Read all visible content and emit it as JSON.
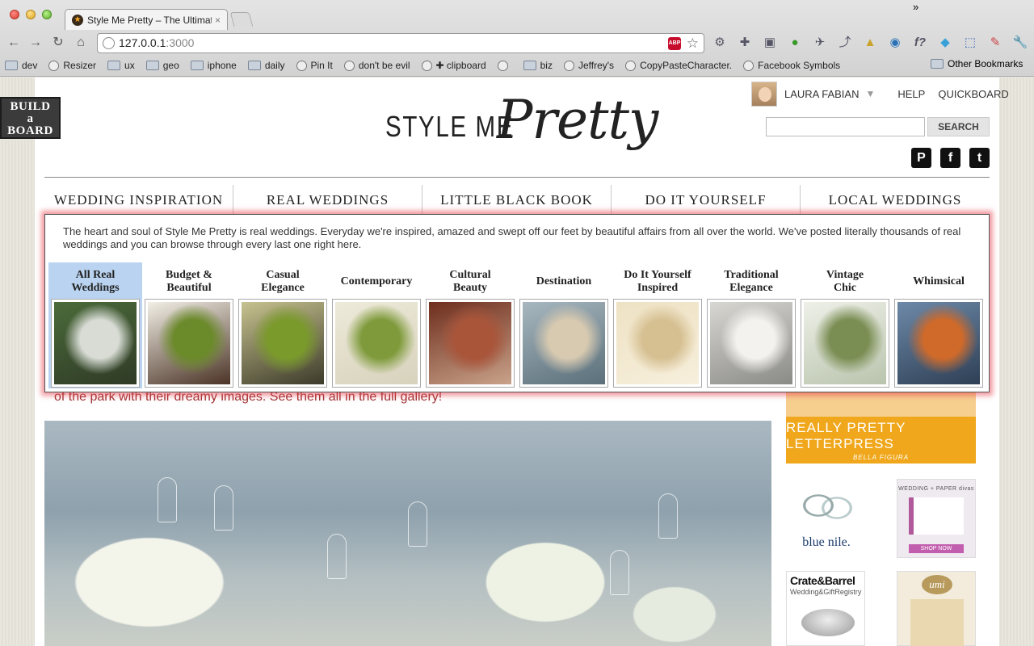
{
  "browser": {
    "tab_title": "Style Me Pretty – The Ultimat",
    "tab_close": "×",
    "url_host": "127.0.0.1",
    "url_port": ":3000",
    "abp_label": "ABP",
    "bookmarks": [
      {
        "label": "dev",
        "icon": "folder"
      },
      {
        "label": "Resizer",
        "icon": "globe"
      },
      {
        "label": "ux",
        "icon": "folder"
      },
      {
        "label": "geo",
        "icon": "folder"
      },
      {
        "label": "iphone",
        "icon": "folder"
      },
      {
        "label": "daily",
        "icon": "folder"
      },
      {
        "label": "Pin It",
        "icon": "globe"
      },
      {
        "label": "don't be evil",
        "icon": "globe"
      },
      {
        "label": "✚ clipboard",
        "icon": "globe"
      },
      {
        "label": "",
        "icon": "globe"
      },
      {
        "label": "biz",
        "icon": "folder"
      },
      {
        "label": "Jeffrey's",
        "icon": "globe"
      },
      {
        "label": "CopyPasteCharacter.",
        "icon": "globe"
      },
      {
        "label": "Facebook Symbols",
        "icon": "globe"
      }
    ],
    "more_bookmarks": "»",
    "other_bookmarks": "Other Bookmarks"
  },
  "site": {
    "build_board": [
      "BUILD",
      "a",
      "BOARD"
    ],
    "logo_left": "STYLE ME",
    "logo_script": "Pretty",
    "user_name": "LAURA FABIAN",
    "help": "HELP",
    "quickboard": "QUICKBOARD",
    "search_button": "SEARCH",
    "search_value": "",
    "social": [
      {
        "name": "pinterest",
        "glyph": "P"
      },
      {
        "name": "facebook",
        "glyph": "f"
      },
      {
        "name": "twitter",
        "glyph": "t"
      }
    ],
    "nav": [
      {
        "label": "WEDDING INSPIRATION",
        "active": false
      },
      {
        "label": "REAL WEDDINGS",
        "active": true
      },
      {
        "label": "LITTLE BLACK BOOK",
        "active": false
      },
      {
        "label": "DO IT YOURSELF",
        "active": false
      },
      {
        "label": "LOCAL WEDDINGS",
        "active": false
      }
    ]
  },
  "dropdown": {
    "intro": "The heart and soul of Style Me Pretty is real weddings. Everyday we're inspired, amazed and swept off our feet by beautiful affairs from all over the world. We've posted literally thousands of real weddings and you can browse through every last one right here.",
    "categories": [
      {
        "label": "All Real\nWeddings",
        "active": true,
        "colors": [
          "#4b6b3a",
          "#d8dcd5",
          "#2f3a26"
        ]
      },
      {
        "label": "Budget &\nBeautiful",
        "active": false,
        "colors": [
          "#f2efe6",
          "#6b8a2a",
          "#4b3326"
        ]
      },
      {
        "label": "Casual\nElegance",
        "active": false,
        "colors": [
          "#c7c28f",
          "#7a9a2b",
          "#3c3a2a"
        ]
      },
      {
        "label": "Contemporary",
        "active": false,
        "colors": [
          "#eeeada",
          "#7e9a3a",
          "#d7d2bc"
        ]
      },
      {
        "label": "Cultural\nBeauty",
        "active": false,
        "colors": [
          "#6e2e1e",
          "#a9553a",
          "#c9a28a"
        ]
      },
      {
        "label": "Destination",
        "active": false,
        "colors": [
          "#a8b7bf",
          "#d8cab0",
          "#5a6f7a"
        ]
      },
      {
        "label": "Do It Yourself\nInspired",
        "active": false,
        "colors": [
          "#eee2c4",
          "#d6c092",
          "#f7efdc"
        ]
      },
      {
        "label": "Traditional\nElegance",
        "active": false,
        "colors": [
          "#d8d7d2",
          "#f3f2ee",
          "#8a8a86"
        ]
      },
      {
        "label": "Vintage\nChic",
        "active": false,
        "colors": [
          "#eef0e8",
          "#7a8d52",
          "#b9c4ad"
        ]
      },
      {
        "label": "Whimsical",
        "active": false,
        "colors": [
          "#6d89a8",
          "#d06a2a",
          "#2e3f55"
        ]
      }
    ]
  },
  "content": {
    "story_text": "of the park with their dreamy images. See them all in the full gallery!",
    "ads": {
      "letterpress_main": "REALLY PRETTY LETTERPRESS",
      "letterpress_sub": "BELLA FIGURA",
      "bluenile": "blue nile.",
      "wedding_paper_title": "WEDDING + PAPER divas",
      "shop_now": "SHOP NOW",
      "crate_logo": "Crate&Barrel",
      "crate_sub": "Wedding&GiftRegistry",
      "umi": "umi"
    }
  }
}
